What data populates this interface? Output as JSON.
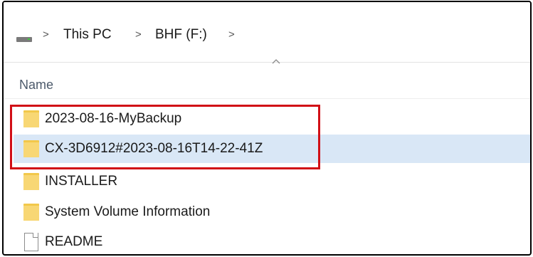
{
  "breadcrumb": {
    "drive_icon": "drive-icon",
    "items": [
      "This PC",
      "BHF (F:)"
    ],
    "separator": ">"
  },
  "columns": {
    "name_label": "Name",
    "sort_indicator": "^"
  },
  "files": [
    {
      "name": "2023-08-16-MyBackup",
      "type": "folder",
      "selected": false
    },
    {
      "name": "CX-3D6912#2023-08-16T14-22-41Z",
      "type": "folder",
      "selected": true
    },
    {
      "name": "INSTALLER",
      "type": "folder",
      "selected": false
    },
    {
      "name": "System Volume Information",
      "type": "folder",
      "selected": false
    },
    {
      "name": "README",
      "type": "file",
      "selected": false
    }
  ],
  "colors": {
    "selected_row": "#d9e7f6",
    "highlight_border": "#d10f16",
    "folder": "#f8d774"
  }
}
